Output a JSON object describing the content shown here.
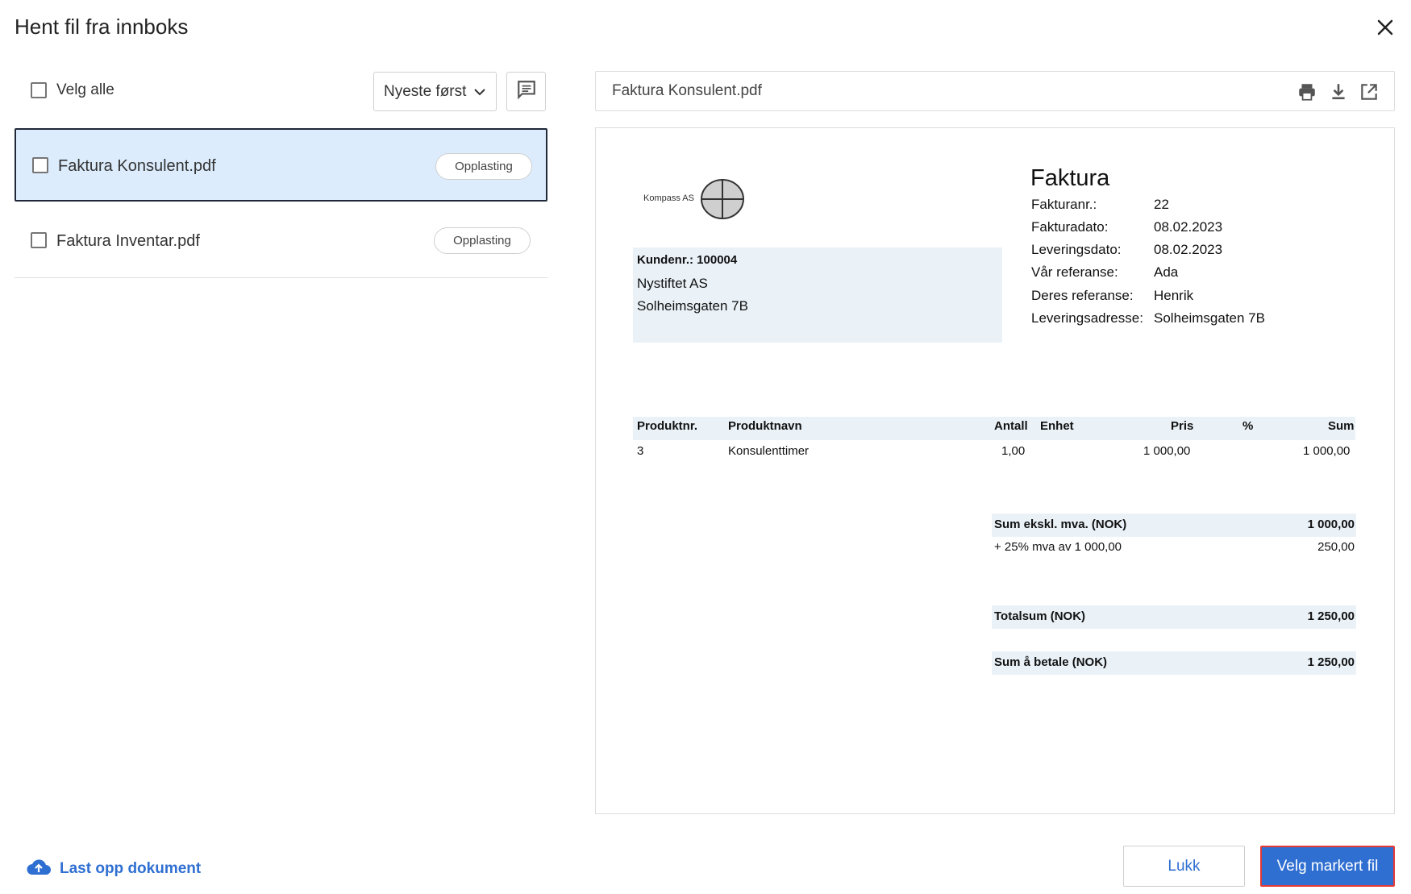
{
  "dialog": {
    "title": "Hent fil fra innboks",
    "close_icon": "close-icon"
  },
  "list": {
    "select_all_label": "Velg alle",
    "sort_value": "Nyeste først",
    "files": [
      {
        "name": "Faktura Konsulent.pdf",
        "tag": "Opplasting",
        "selected": true
      },
      {
        "name": "Faktura Inventar.pdf",
        "tag": "Opplasting",
        "selected": false
      }
    ]
  },
  "preview": {
    "filename": "Faktura Konsulent.pdf",
    "icons": [
      "print-icon",
      "download-icon",
      "open-external-icon"
    ],
    "invoice": {
      "logo_text": "Kompass AS",
      "title": "Faktura",
      "rows": [
        {
          "label": "Fakturanr.:",
          "value": "22"
        },
        {
          "label": "Fakturadato:",
          "value": "08.02.2023"
        },
        {
          "label": "Leveringsdato:",
          "value": "08.02.2023"
        },
        {
          "label": "Vår referanse:",
          "value": "Ada"
        },
        {
          "label": "Deres referanse:",
          "value": "Henrik"
        },
        {
          "label": "Leveringsadresse:",
          "value": "Solheimsgaten 7B"
        }
      ],
      "customer": {
        "number_label": "Kundenr.: 100004",
        "name": "Nystiftet AS",
        "address": "Solheimsgaten 7B"
      },
      "table": {
        "headers": [
          "Produktnr.",
          "Produktnavn",
          "Antall",
          "Enhet",
          "Pris",
          "%",
          "Sum"
        ],
        "rows": [
          [
            "3",
            "Konsulenttimer",
            "1,00",
            "",
            "1 000,00",
            "",
            "1 000,00"
          ]
        ]
      },
      "totals": {
        "excl_label": "Sum ekskl. mva. (NOK)",
        "excl_value": "1 000,00",
        "vat_label": "+ 25% mva av 1 000,00",
        "vat_value": "250,00",
        "total_label": "Totalsum (NOK)",
        "total_value": "1 250,00",
        "pay_label": "Sum å betale (NOK)",
        "pay_value": "1 250,00"
      }
    }
  },
  "footer": {
    "upload_label": "Last opp dokument",
    "close_label": "Lukk",
    "primary_label": "Velg markert fil"
  },
  "colors": {
    "accent": "#2f6fd1",
    "selected_bg": "#dcecfc",
    "table_band": "#eaf2f8",
    "highlight_border": "#e53935"
  }
}
